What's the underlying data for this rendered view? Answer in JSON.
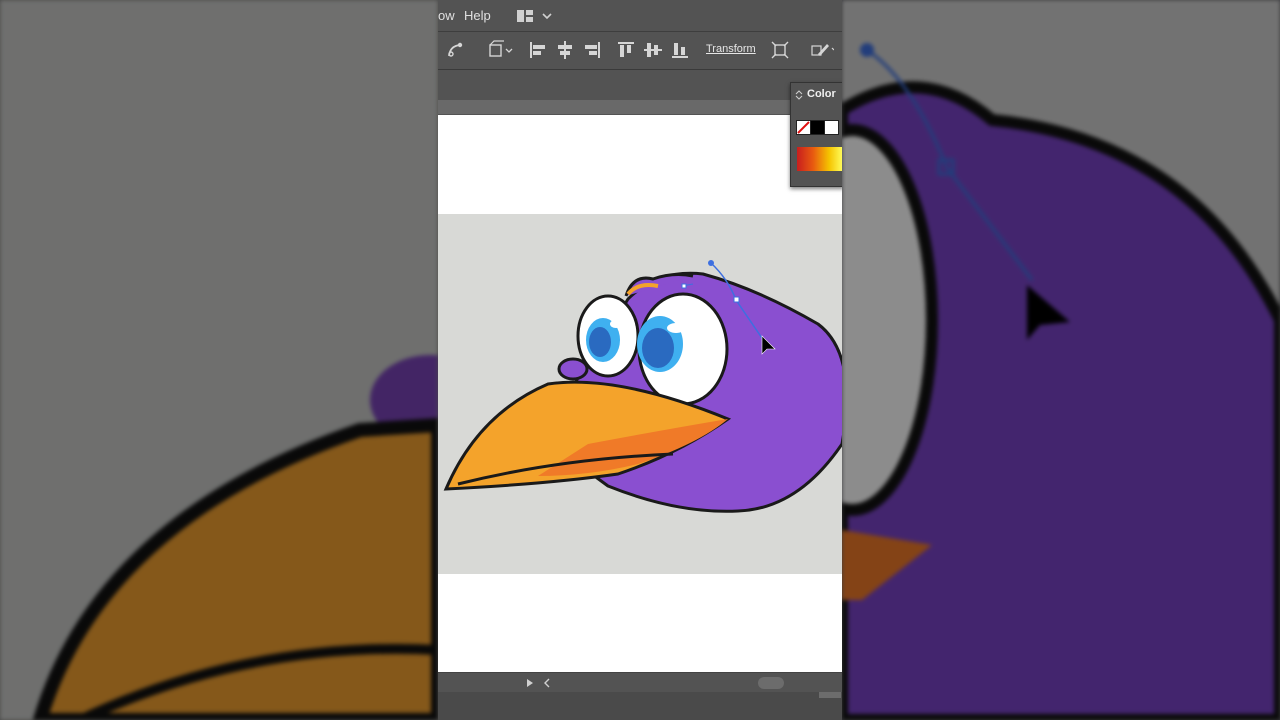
{
  "menubar": {
    "partial_item": "ow",
    "help": "Help"
  },
  "toolbar": {
    "transform_label": "Transform"
  },
  "color_panel": {
    "title": "Color",
    "colors": {
      "black": "#000000",
      "white": "#ffffff"
    }
  },
  "colors": {
    "bird_purple": "#8a4fd0",
    "beak_orange": "#f4a32b",
    "beak_dark": "#f07a28",
    "eye_blue": "#2a7ad1",
    "eye_light_blue": "#3fb0f0",
    "path_blue": "#3d6fe0"
  }
}
